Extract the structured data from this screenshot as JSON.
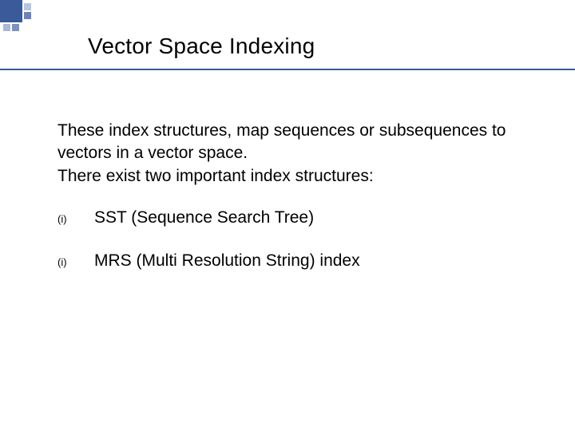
{
  "slide": {
    "title": "Vector Space Indexing",
    "intro_line1": "These index structures, map sequences or subsequences to vectors in a vector space.",
    "intro_line2": "There exist two important index structures:",
    "items": [
      {
        "marker": "(i)",
        "text": "SST (Sequence Search Tree)"
      },
      {
        "marker": "(i)",
        "text": "MRS (Multi Resolution String) index"
      }
    ]
  }
}
